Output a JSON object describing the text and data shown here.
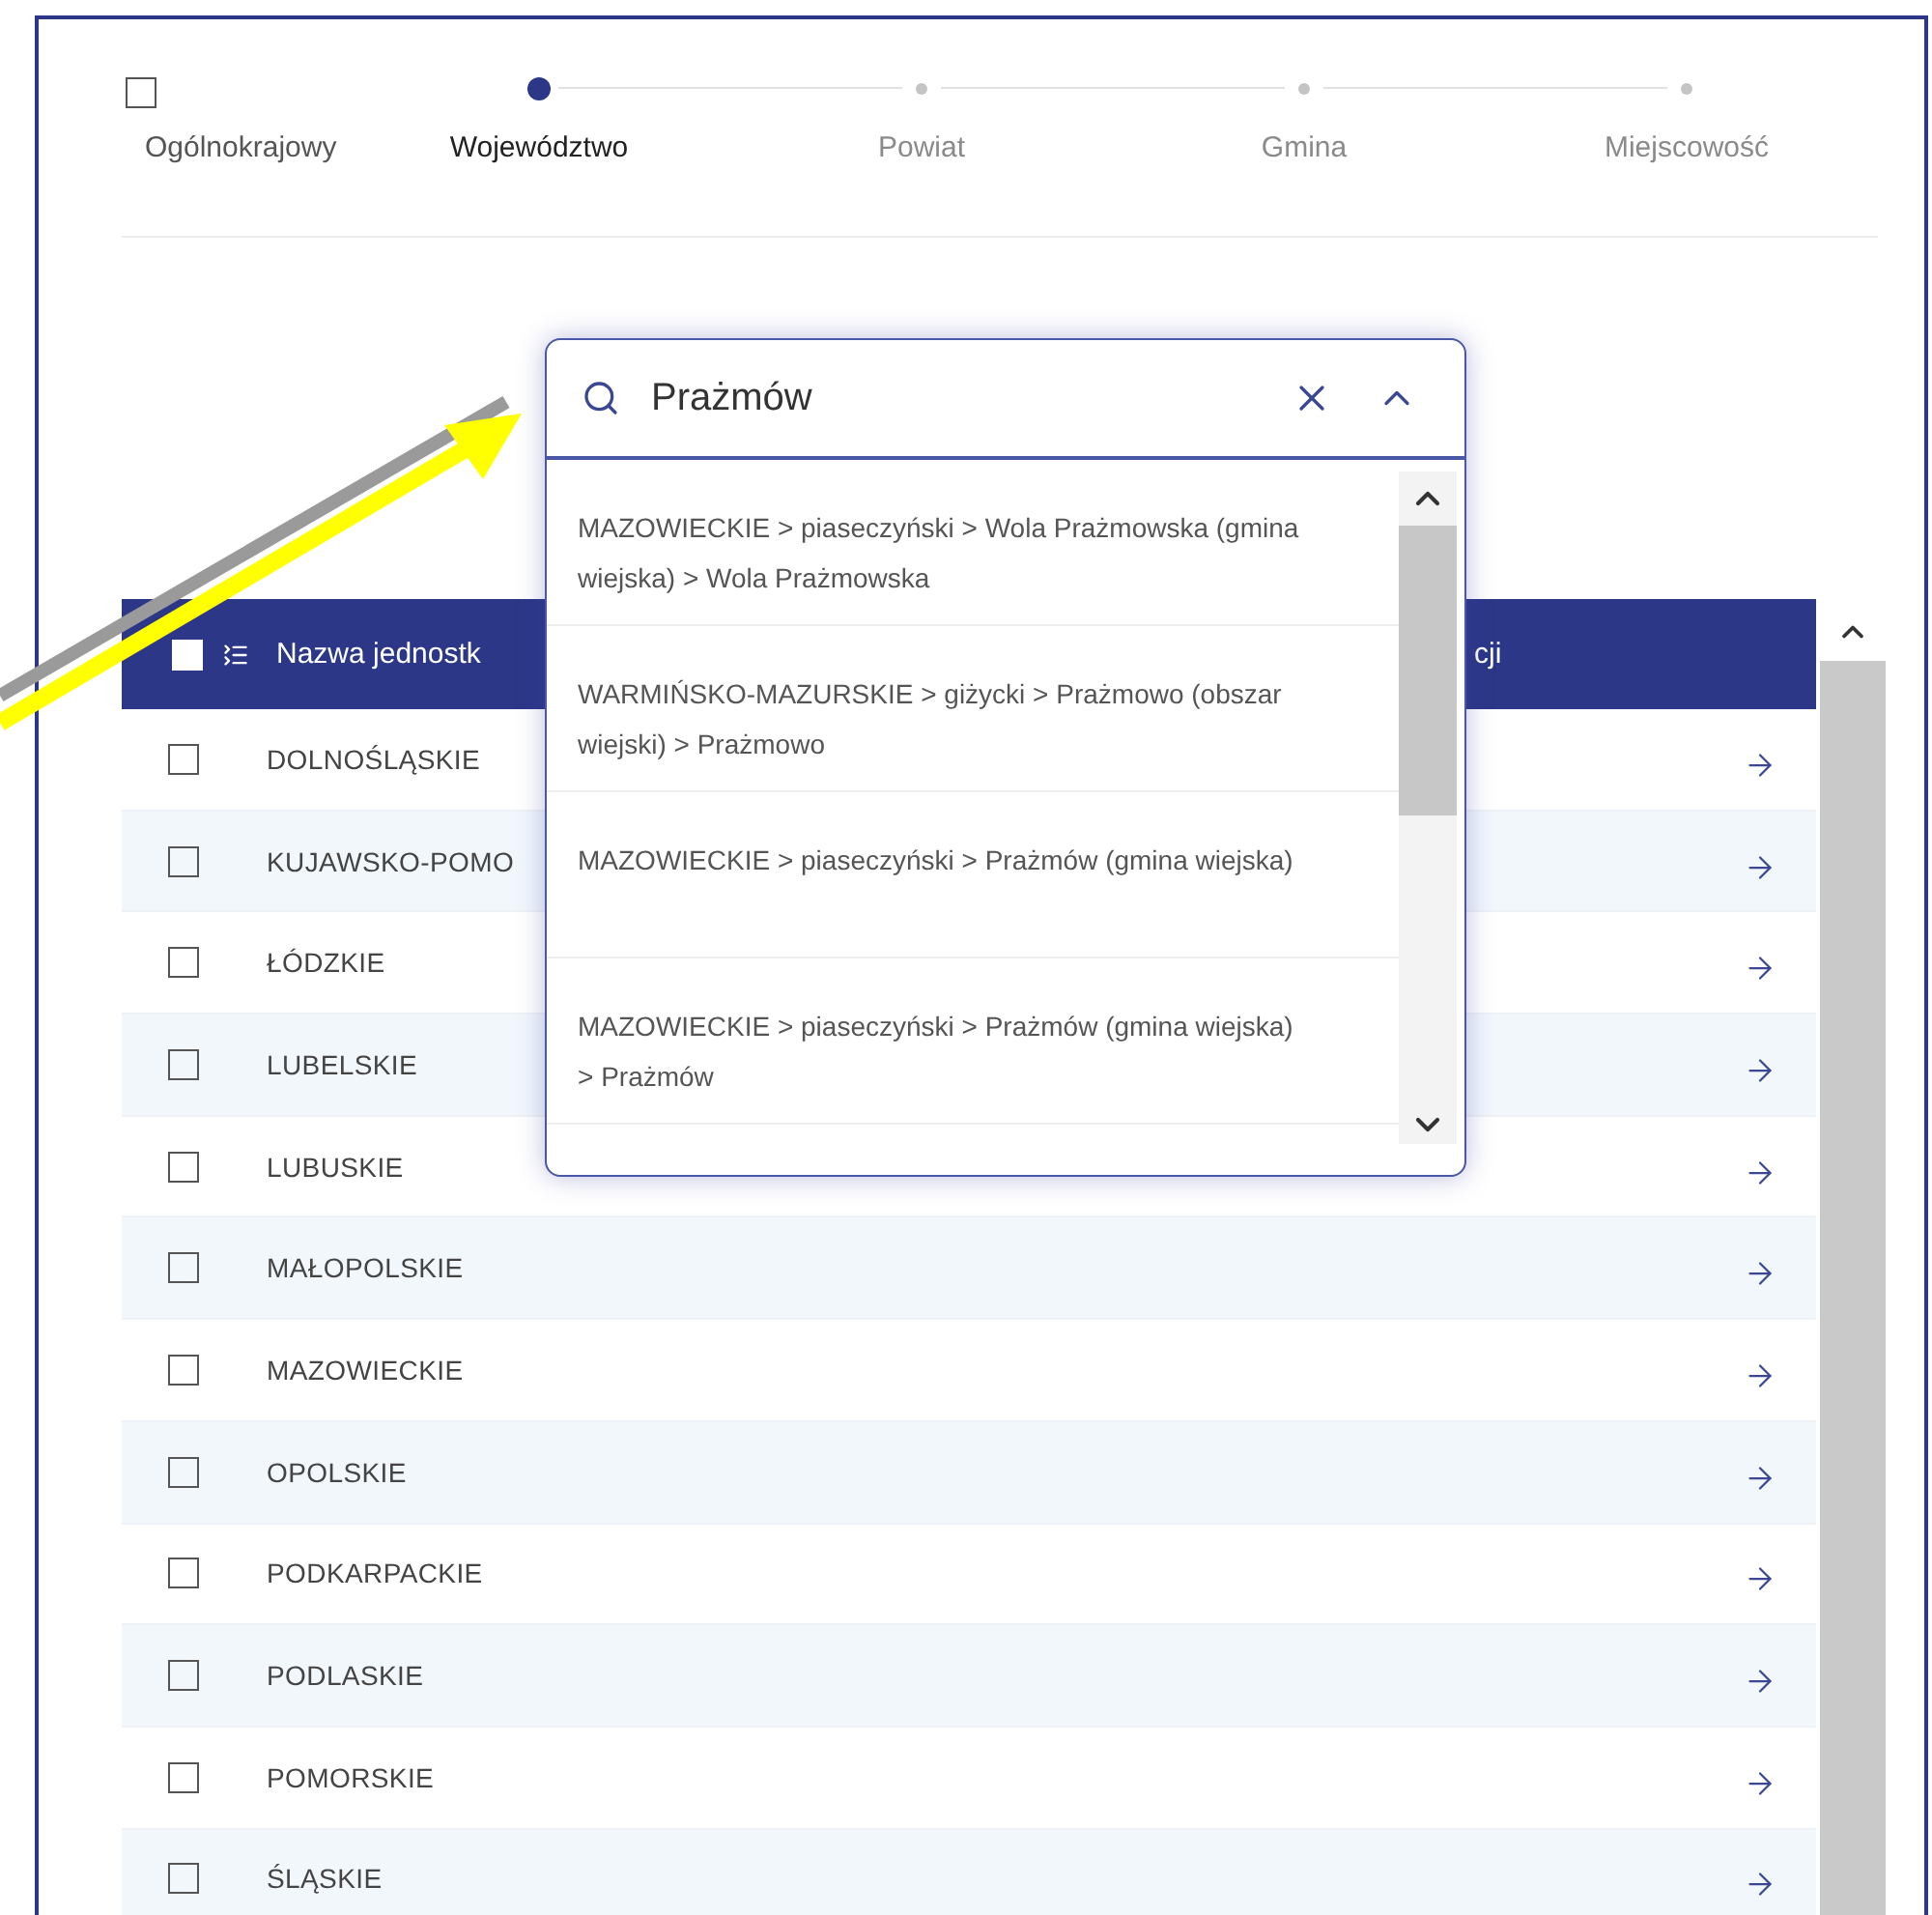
{
  "scope": {
    "label": "Ogólnokrajowy",
    "checked": false
  },
  "steps": [
    {
      "label": "Województwo",
      "selected": true
    },
    {
      "label": "Powiat",
      "selected": false
    },
    {
      "label": "Gmina",
      "selected": false
    },
    {
      "label": "Miejscowość",
      "selected": false
    }
  ],
  "table": {
    "header_checked": false,
    "columns": [
      "Nazwa jednostk",
      "cji"
    ],
    "rows": [
      {
        "name": "DOLNOŚLĄSKIE",
        "checked": false
      },
      {
        "name": "KUJAWSKO-POMO",
        "checked": false
      },
      {
        "name": "ŁÓDZKIE",
        "checked": false
      },
      {
        "name": "LUBELSKIE",
        "checked": false
      },
      {
        "name": "LUBUSKIE",
        "checked": false
      },
      {
        "name": "MAŁOPOLSKIE",
        "checked": false
      },
      {
        "name": "MAZOWIECKIE",
        "checked": false
      },
      {
        "name": "OPOLSKIE",
        "checked": false
      },
      {
        "name": "PODKARPACKIE",
        "checked": false
      },
      {
        "name": "PODLASKIE",
        "checked": false
      },
      {
        "name": "POMORSKIE",
        "checked": false
      },
      {
        "name": "ŚLĄSKIE",
        "checked": false
      }
    ]
  },
  "search": {
    "value": "Prażmów",
    "results": [
      "MAZOWIECKIE > piaseczyński > Wola Prażmowska (gmina wiejska) > Wola Prażmowska",
      "WARMIŃSKO-MAZURSKIE > giżycki > Prażmowo (obszar wiejski) > Prażmowo",
      "MAZOWIECKIE > piaseczyński > Prażmów (gmina wiejska)",
      "MAZOWIECKIE > piaseczyński > Prażmów (gmina wiejska) > Prażmów"
    ]
  }
}
